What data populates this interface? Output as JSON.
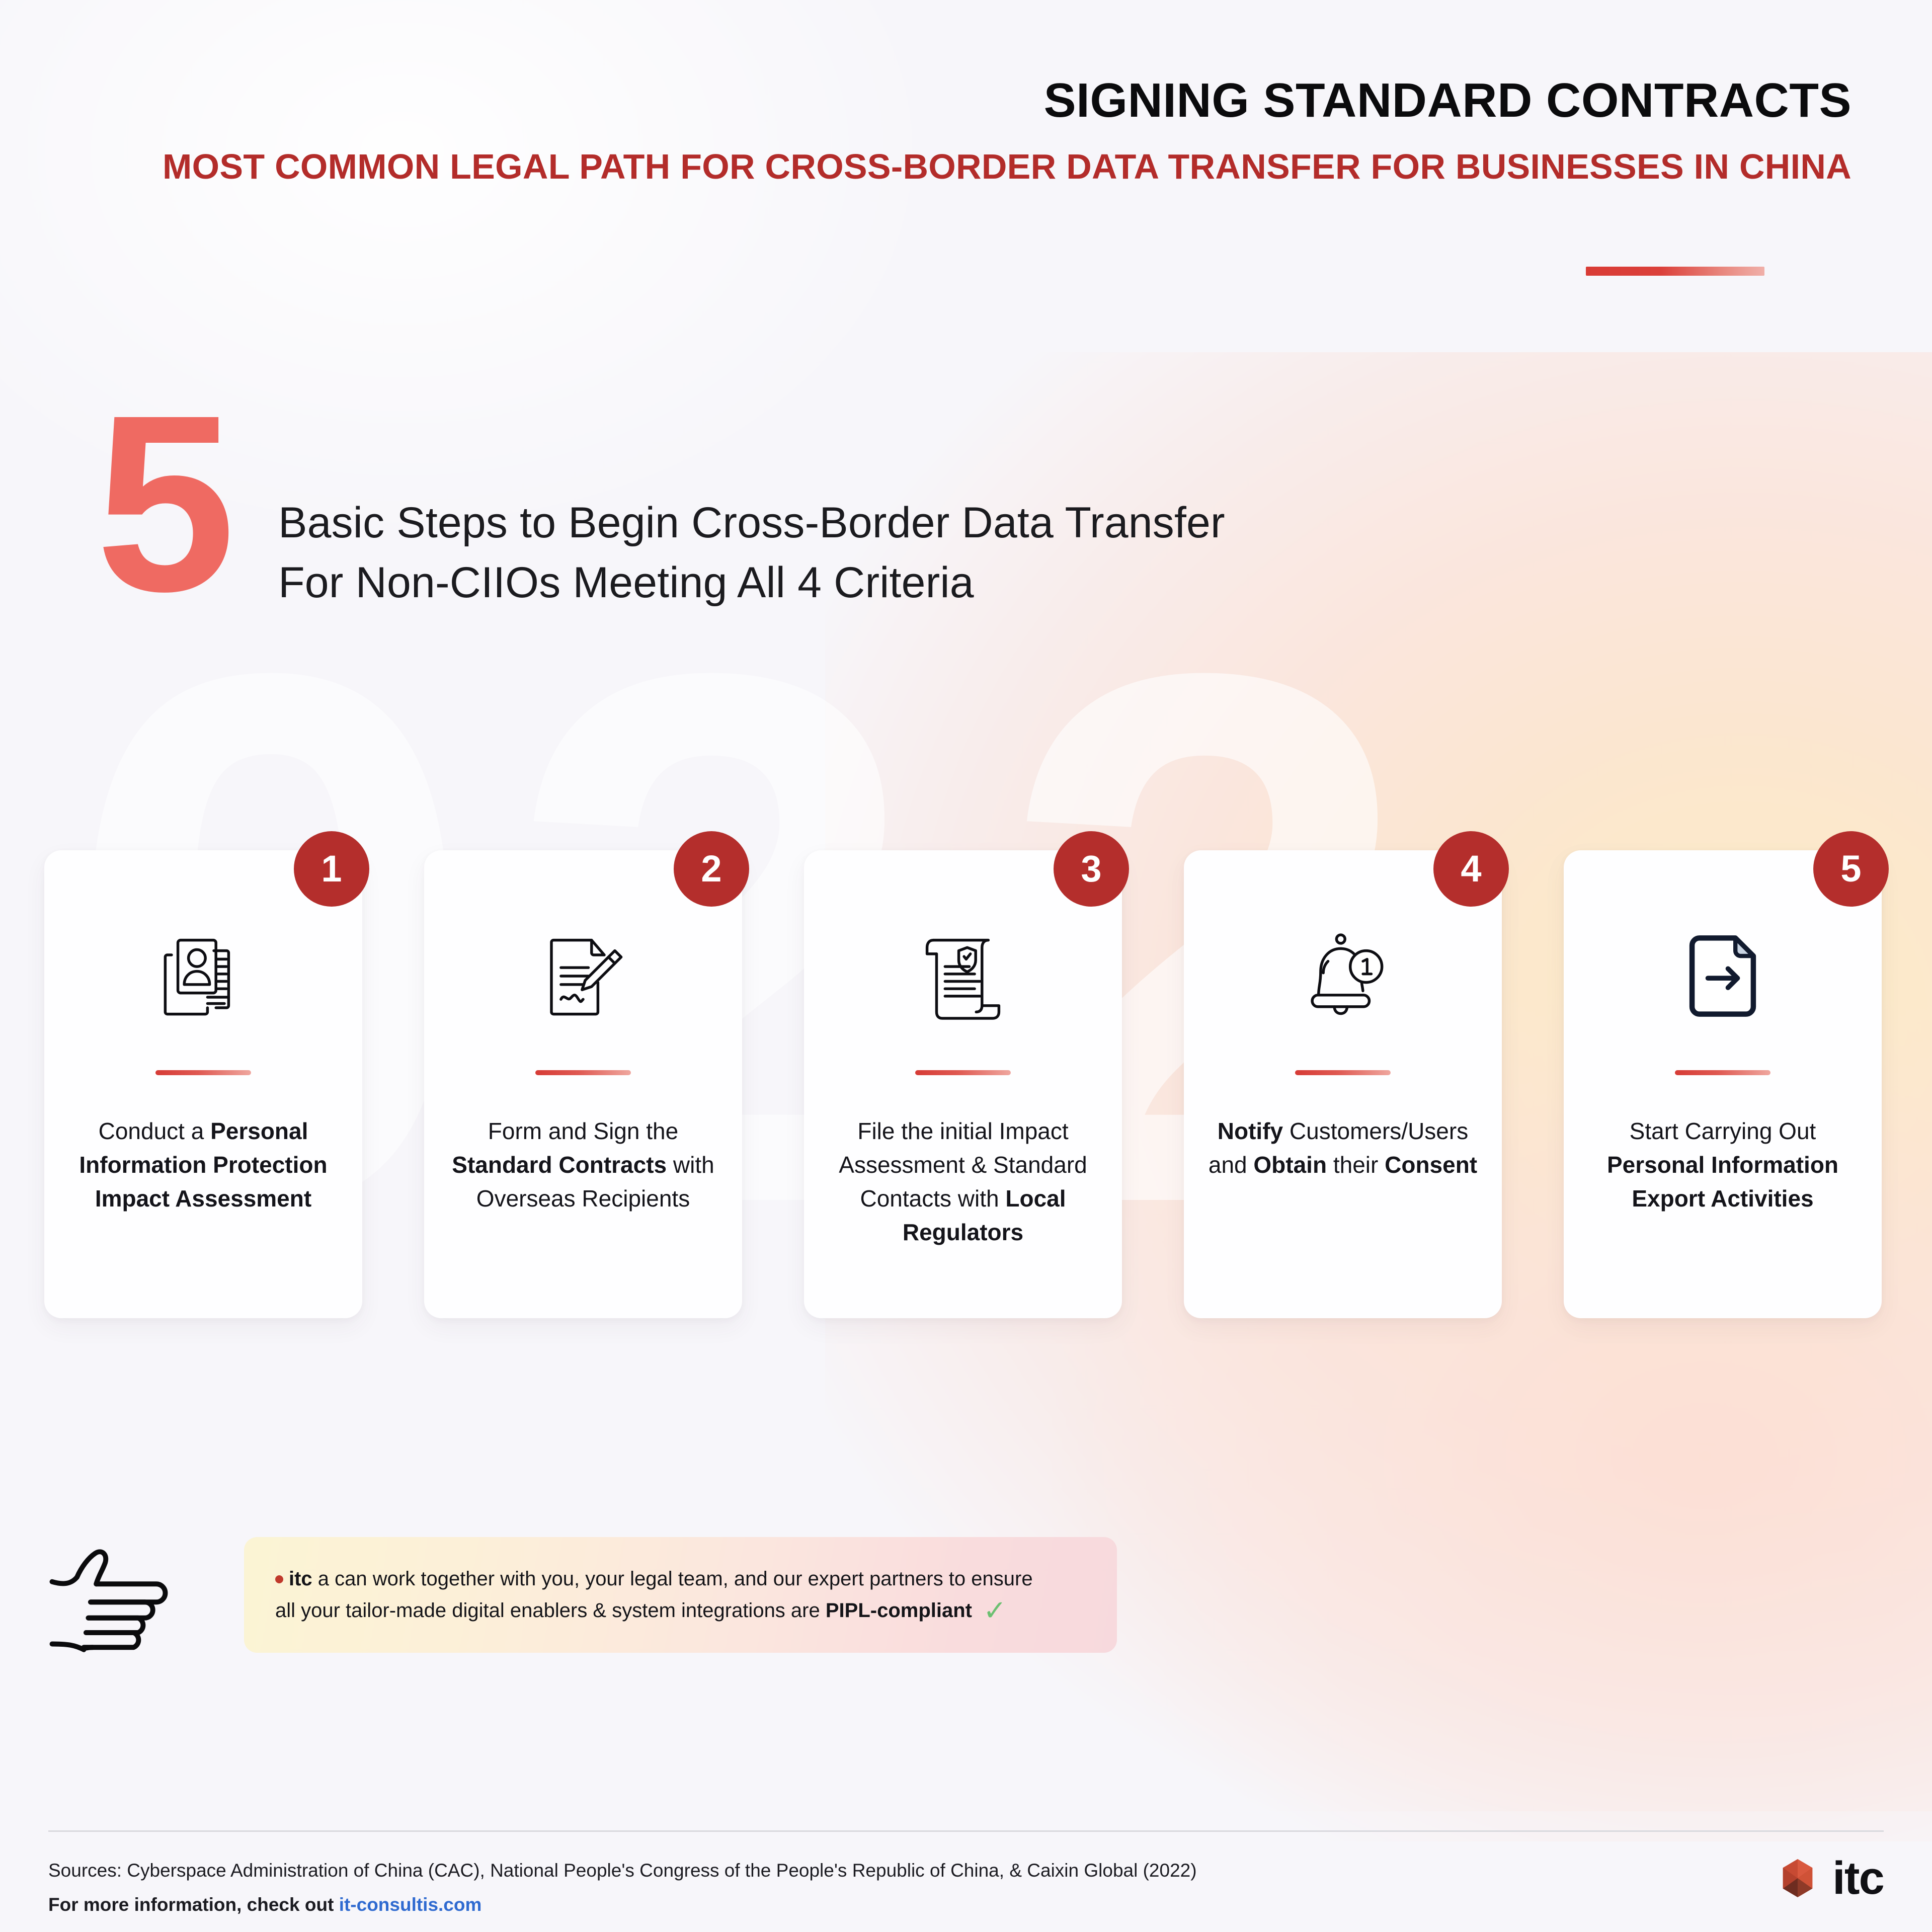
{
  "header": {
    "title": "SIGNING STANDARD CONTRACTS",
    "subtitle": "MOST COMMON LEGAL PATH FOR CROSS-BORDER DATA TRANSFER FOR BUSINESSES IN CHINA"
  },
  "lead": {
    "numeral": "5",
    "text": "Basic Steps to Begin Cross-Border Data Transfer\nFor Non-CIIOs Meeting All 4 Criteria"
  },
  "cards": [
    {
      "badge": "1",
      "icon": "id-card-documents-icon",
      "text_parts": [
        {
          "t": "Conduct a ",
          "bold": false
        },
        {
          "t": "Personal Information Protection Impact Assessment",
          "bold": true
        }
      ]
    },
    {
      "badge": "2",
      "icon": "signed-document-pen-icon",
      "text_parts": [
        {
          "t": "Form and Sign the ",
          "bold": false
        },
        {
          "t": "Standard Contracts",
          "bold": true
        },
        {
          "t": " with Overseas Recipients",
          "bold": false
        }
      ]
    },
    {
      "badge": "3",
      "icon": "scroll-shield-icon",
      "text_parts": [
        {
          "t": "File the initial Impact Assessment & Standard Contacts with ",
          "bold": false
        },
        {
          "t": "Local Regulators",
          "bold": true
        }
      ]
    },
    {
      "badge": "4",
      "icon": "bell-notification-icon",
      "text_parts": [
        {
          "t": "Notify",
          "bold": true
        },
        {
          "t": " Customers/Users and ",
          "bold": false
        },
        {
          "t": "Obtain",
          "bold": true
        },
        {
          "t": " their ",
          "bold": false
        },
        {
          "t": "Consent",
          "bold": true
        }
      ]
    },
    {
      "badge": "5",
      "icon": "document-export-arrow-icon",
      "text_parts": [
        {
          "t": "Start Carrying Out ",
          "bold": false
        },
        {
          "t": "Personal Information Export Activities",
          "bold": true
        }
      ]
    }
  ],
  "callout": {
    "icon": "pointing-hand-icon",
    "line1_parts": [
      {
        "t": "itc",
        "bold": true
      },
      {
        "t": " a can work together with you, your legal team, and our expert partners to ensure",
        "bold": false
      }
    ],
    "line2_parts": [
      {
        "t": "all your tailor-made digital enablers & system integrations are ",
        "bold": false
      },
      {
        "t": "PIPL-compliant",
        "bold": true
      }
    ],
    "check": "✓"
  },
  "footer": {
    "sources": "Sources: Cyberspace Administration of China (CAC), National People's Congress of the People's Republic of China, & Caixin Global (2022)",
    "more_prefix": "For more information, check out ",
    "link": "it-consultis.com"
  },
  "brand": {
    "mark": "itc-polygon-logo",
    "word": "itc"
  },
  "watermarks": [
    "0",
    "2",
    "2"
  ],
  "colors": {
    "background": "#f7f6fa",
    "title": "#0b0b0d",
    "subtitle_red": "#b32c2a",
    "numeral_coral": "#ef6a62",
    "badge_red": "#b42e2c",
    "accent_red": "#d93b35",
    "link_blue": "#2f6ad0",
    "check_green": "#6cc071"
  }
}
